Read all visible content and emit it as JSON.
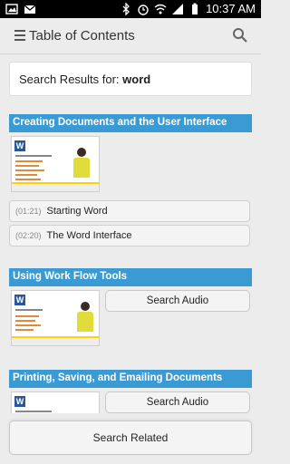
{
  "status_bar": {
    "time": "10:37 AM"
  },
  "app_bar": {
    "title": "Table of Contents",
    "menu_icon": "hamburger-menu-icon",
    "search_icon": "search-icon"
  },
  "search": {
    "prefix": "Search Results for: ",
    "term": "word"
  },
  "sections": [
    {
      "title": "Creating Documents and the User Interface",
      "chapters": [
        {
          "time": "(01:21)",
          "label": "Starting Word"
        },
        {
          "time": "(02:20)",
          "label": "The Word Interface"
        }
      ]
    },
    {
      "title": "Using Work Flow Tools",
      "audio_button": "Search Audio"
    },
    {
      "title": "Printing, Saving, and Emailing Documents",
      "audio_button": "Search Audio"
    }
  ],
  "footer": {
    "related_button": "Search Related"
  },
  "colors": {
    "section_bar": "#3a9bd4",
    "status_bar": "#000000",
    "background": "#ececec"
  }
}
